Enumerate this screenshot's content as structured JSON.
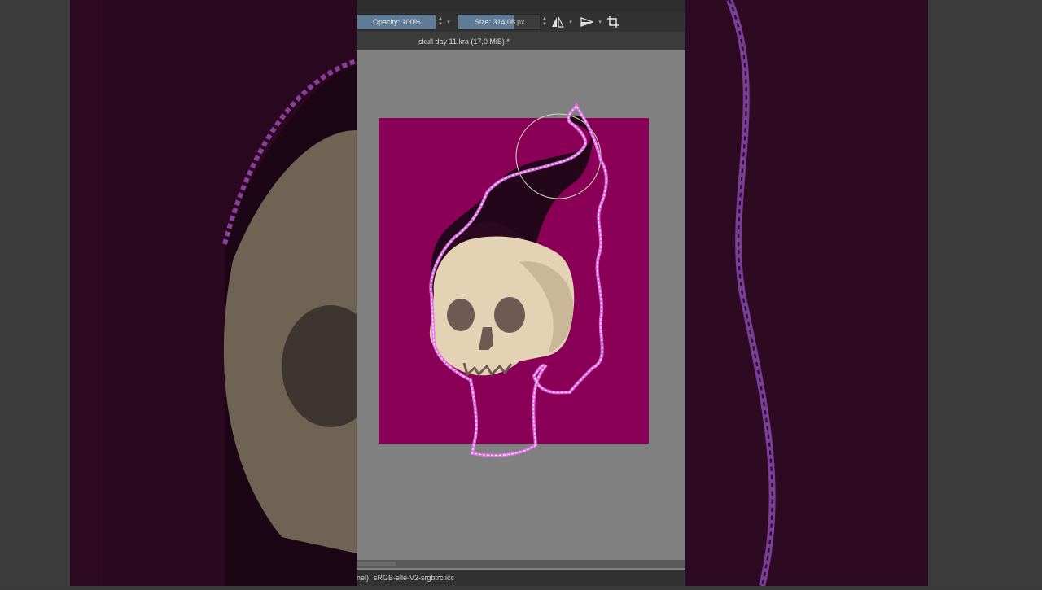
{
  "toolbar": {
    "opacity_label": "Opacity: 100%",
    "opacity_value": 1.0,
    "size_label": "Size: 314,08",
    "size_unit": "px"
  },
  "document": {
    "tab_title": "skull day 11.kra (17,0 MiB) *"
  },
  "status": {
    "prefix": "nel)",
    "color_profile": "sRGB-elle-V2-srgbtrc.icc"
  },
  "colors": {
    "canvas_bg": "#8a0057",
    "shadow": "#23061a",
    "skull": "#e3d3b4",
    "skull_shade": "#b8a68d",
    "eye": "#6e5a52",
    "selection_glow": "#e86cf0",
    "workspace": "#808080"
  },
  "icons": [
    "mirror-horizontal-icon",
    "wrap-around-icon",
    "crop-icon"
  ]
}
